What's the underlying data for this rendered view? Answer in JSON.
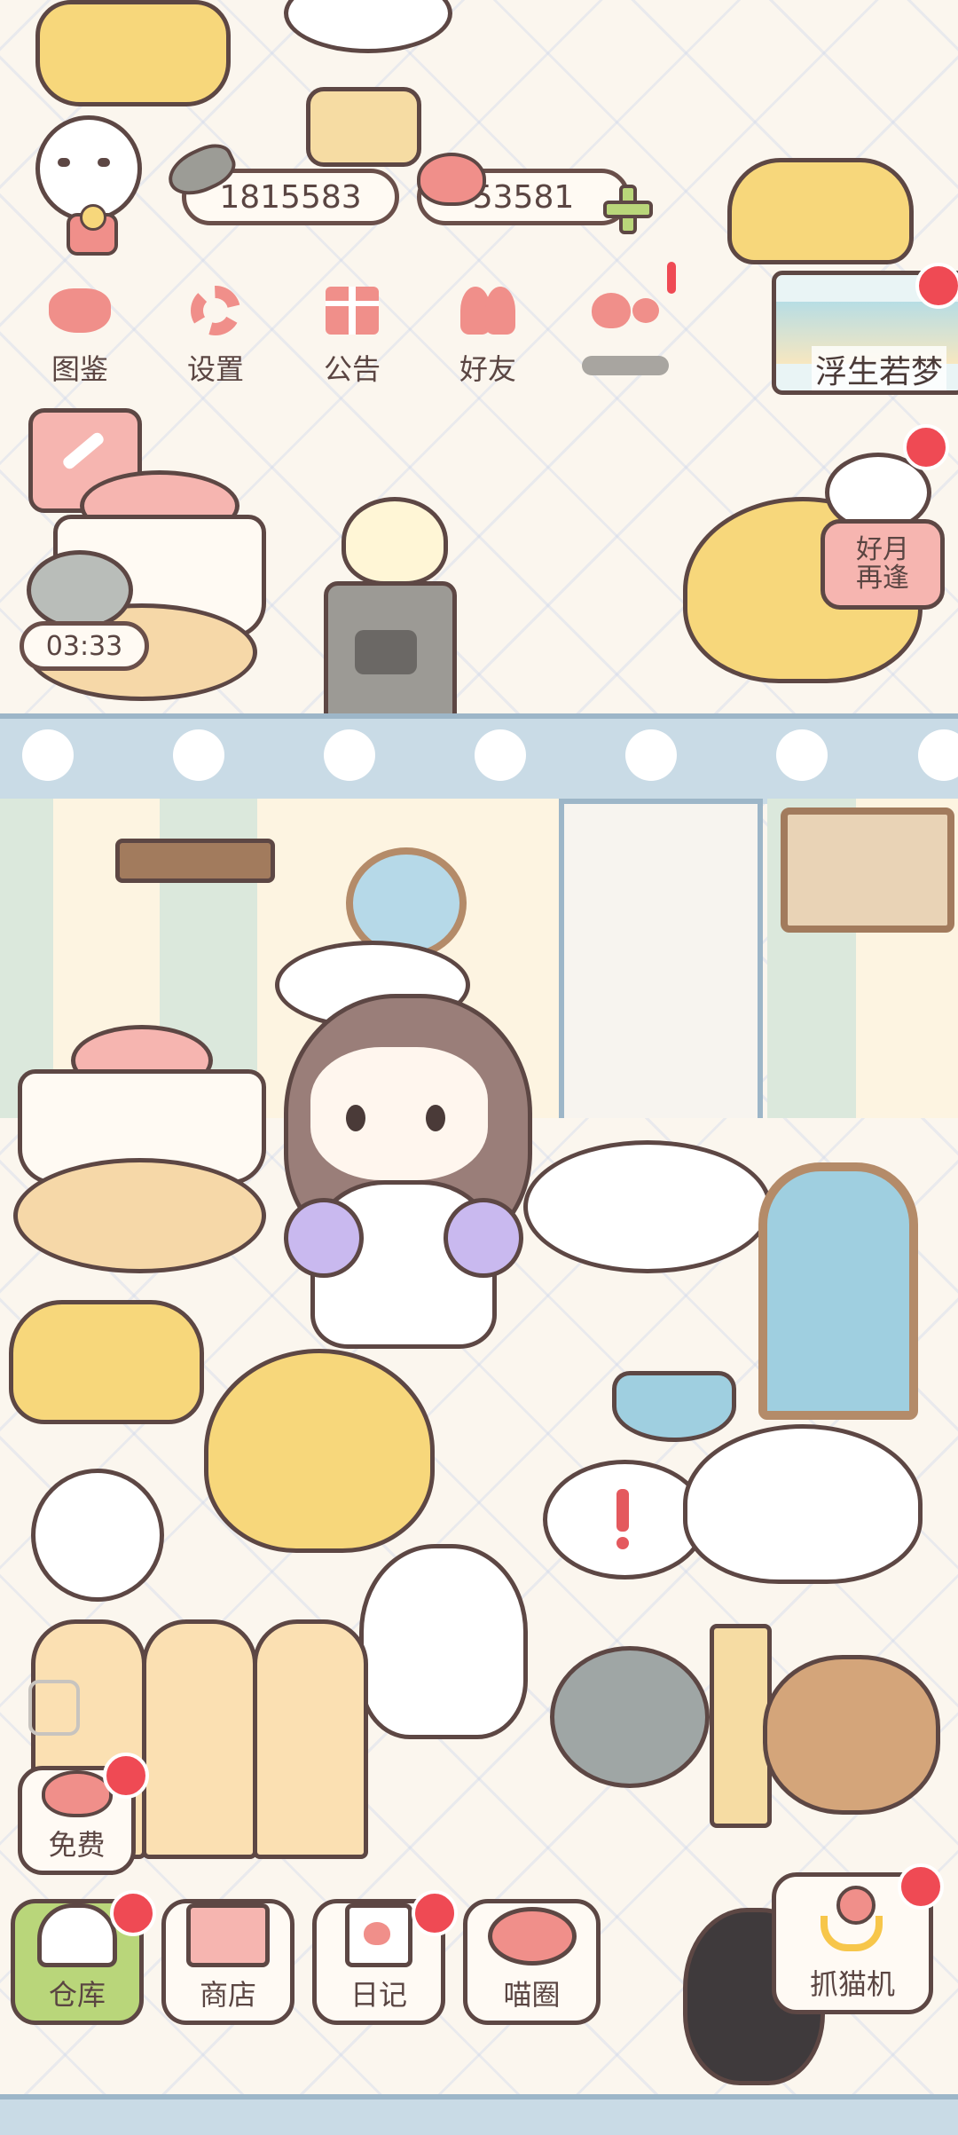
{
  "currency": {
    "coins": "1815583",
    "hearts": "53581"
  },
  "top_menu": [
    {
      "label": "图鉴"
    },
    {
      "label": "设置"
    },
    {
      "label": "公告"
    },
    {
      "label": "好友"
    },
    {
      "label": ""
    }
  ],
  "event_banner": {
    "title": "浮生若梦"
  },
  "side_event": {
    "title_line1": "好月",
    "title_line2": "再逢"
  },
  "timer": {
    "value": "03:33"
  },
  "free_button": {
    "label": "免费"
  },
  "bottom_bar": {
    "warehouse": "仓库",
    "shop": "商店",
    "diary": "日记",
    "cat_circle": "喵圈",
    "claw_machine": "抓猫机"
  },
  "colors": {
    "accent_red": "#ef4a54",
    "outline": "#5d4744",
    "warehouse_green": "#b9d67a",
    "pink": "#f08f8a",
    "yellow": "#f7d77b",
    "wall_blue": "#c9dbe6"
  }
}
